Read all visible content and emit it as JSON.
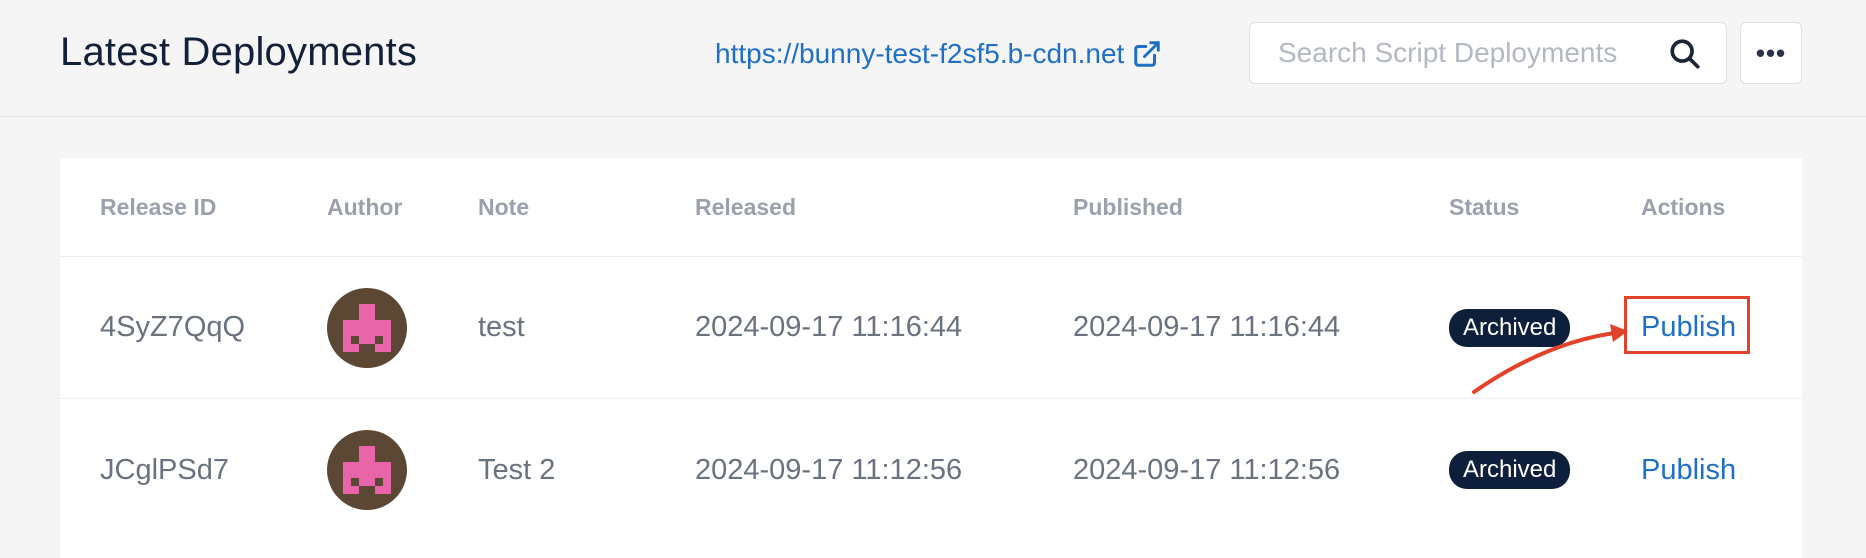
{
  "header": {
    "title": "Latest Deployments",
    "cdn_url": "https://bunny-test-f2sf5.b-cdn.net",
    "search_placeholder": "Search Script Deployments",
    "more_label": "•••"
  },
  "table": {
    "columns": [
      "Release ID",
      "Author",
      "Note",
      "Released",
      "Published",
      "Status",
      "Actions"
    ],
    "rows": [
      {
        "release_id": "4SyZ7QqQ",
        "note": "test",
        "released": "2024-09-17 11:16:44",
        "published": "2024-09-17 11:16:44",
        "status": "Archived",
        "action": "Publish"
      },
      {
        "release_id": "JCglPSd7",
        "note": "Test 2",
        "released": "2024-09-17 11:12:56",
        "published": "2024-09-17 11:12:56",
        "status": "Archived",
        "action": "Publish"
      }
    ]
  },
  "colors": {
    "link": "#1f6fc5",
    "badge_bg": "#0d1f3a",
    "annotation": "#e0422a",
    "avatar_bg": "#5b4733",
    "avatar_fg": "#e765a8"
  },
  "icons": [
    "external-link-icon",
    "search-icon",
    "more-icon",
    "avatar-identicon"
  ]
}
